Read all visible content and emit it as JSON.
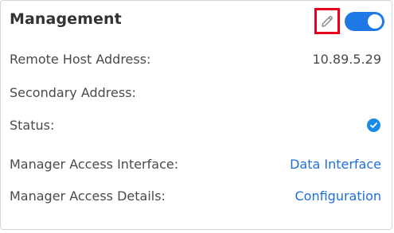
{
  "header": {
    "title": "Management",
    "edit_icon": "pencil-icon",
    "toggle_state": "on",
    "accent_color": "#1e79e6",
    "highlight_color": "#e8001c"
  },
  "rows": {
    "remote_host": {
      "label": "Remote Host Address:",
      "value": "10.89.5.29"
    },
    "secondary": {
      "label": "Secondary Address:",
      "value": ""
    },
    "status": {
      "label": "Status:",
      "icon": "check-circle-icon"
    },
    "access_interface": {
      "label": "Manager Access Interface:",
      "link": "Data Interface"
    },
    "access_details": {
      "label": "Manager Access Details:",
      "link": "Configuration"
    }
  }
}
